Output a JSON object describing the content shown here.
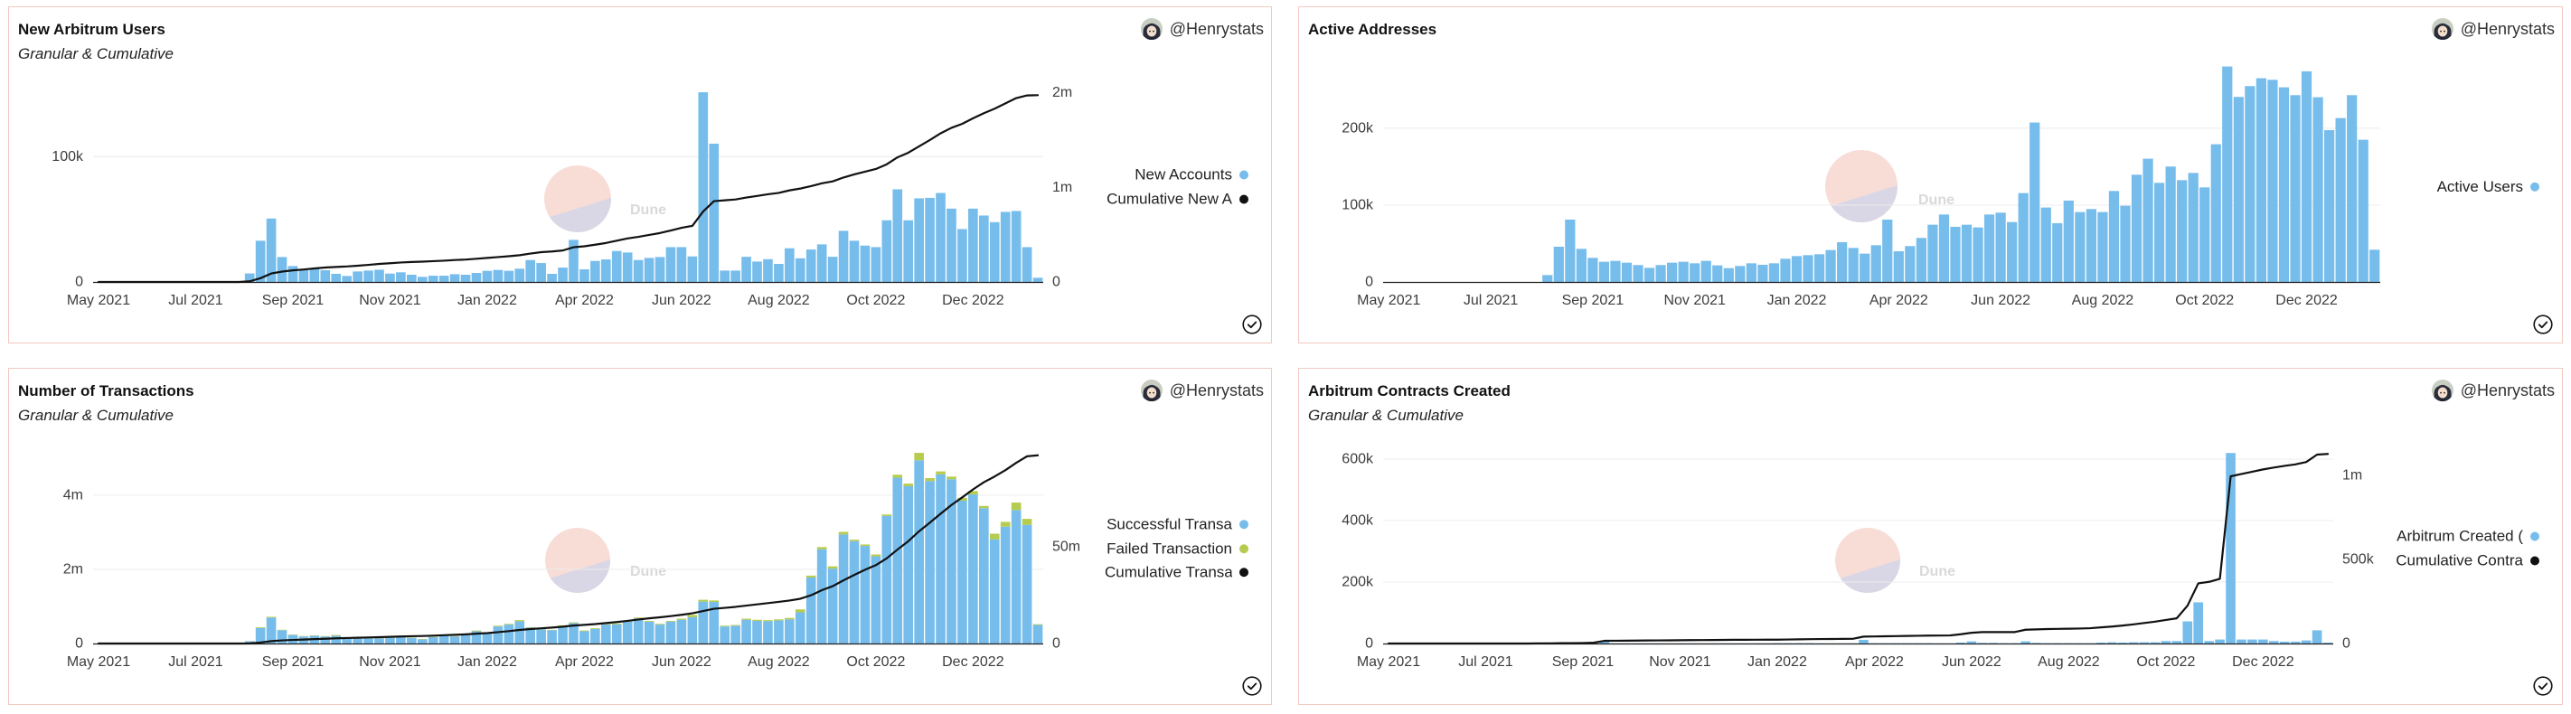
{
  "panels": [
    {
      "author": "@Henrystats"
    },
    {
      "author": "@Henrystats"
    },
    {
      "author": "@Henrystats"
    },
    {
      "author": "@Henrystats"
    }
  ],
  "watermark": {
    "text": "Dune",
    "colors": {
      "top": "#f8ddd6",
      "bottom": "#d9d7e6"
    }
  },
  "colors": {
    "bar_blue": "#77bdec",
    "failed_green": "#b6cc4e",
    "line_black": "#111111",
    "panel_border": "#f2c9c1",
    "grid": "#ececec"
  },
  "chart_data": [
    {
      "type": "bar",
      "title": "New Arbitrum Users",
      "subtitle": "Granular & Cumulative",
      "legend": "right",
      "x_count": 88,
      "x_tick_indices": [
        0,
        9,
        18,
        27,
        36,
        45,
        54,
        63,
        72,
        81
      ],
      "x_tick_labels": [
        "May 2021",
        "Jul 2021",
        "Sep 2021",
        "Nov 2021",
        "Jan 2022",
        "Apr 2022",
        "Jun 2022",
        "Aug 2022",
        "Oct 2022",
        "Dec 2022"
      ],
      "y_left": {
        "ylim": [
          0,
          160000
        ],
        "ticks": [
          0,
          100000
        ],
        "tick_labels": [
          "0",
          "100k"
        ],
        "grid": true
      },
      "y_right": {
        "ylim": [
          0,
          2120000
        ],
        "ticks": [
          0,
          1000000,
          2000000
        ],
        "tick_labels": [
          "0",
          "1m",
          "2m"
        ]
      },
      "series": [
        {
          "name": "New Accounts",
          "kind": "bar",
          "axis": "left",
          "color": "#77bdec",
          "values": [
            0,
            0,
            0,
            0,
            0,
            0,
            0,
            0,
            0,
            0,
            0,
            0,
            0,
            0,
            6800,
            32900,
            50600,
            19900,
            12700,
            9400,
            10800,
            9400,
            6500,
            4800,
            8400,
            9100,
            9800,
            6700,
            7700,
            5800,
            4100,
            5000,
            5000,
            6200,
            5800,
            7200,
            8900,
            9600,
            8900,
            10600,
            17500,
            15100,
            6500,
            11500,
            33600,
            10100,
            16800,
            18000,
            24700,
            23500,
            17500,
            19200,
            19900,
            27800,
            27800,
            20400,
            151300,
            110300,
            9100,
            9100,
            20100,
            16300,
            18200,
            14400,
            26900,
            18900,
            25900,
            30000,
            20100,
            40800,
            32900,
            29000,
            27800,
            49200,
            73900,
            49200,
            66700,
            67100,
            71000,
            58500,
            42200,
            58500,
            53000,
            47700,
            55900,
            56600,
            27800,
            3400
          ]
        },
        {
          "name": "Cumulative New A",
          "kind": "line",
          "axis": "right",
          "color": "#111111",
          "values": [
            0,
            0,
            0,
            0,
            0,
            0,
            0,
            0,
            0,
            0,
            0,
            0,
            0,
            0,
            7000,
            40000,
            90000,
            110000,
            123000,
            132000,
            143000,
            153000,
            159000,
            164000,
            172000,
            181000,
            191000,
            198000,
            206000,
            211000,
            215000,
            220000,
            225000,
            232000,
            237000,
            245000,
            254000,
            263000,
            272000,
            283000,
            300000,
            315000,
            322000,
            333000,
            367000,
            377000,
            394000,
            412000,
            436000,
            460000,
            477000,
            497000,
            517000,
            544000,
            572000,
            593000,
            744000,
            854000,
            863000,
            872000,
            892000,
            909000,
            927000,
            941000,
            968000,
            987000,
            1013000,
            1043000,
            1063000,
            1104000,
            1137000,
            1166000,
            1194000,
            1243000,
            1317000,
            1366000,
            1433000,
            1500000,
            1571000,
            1629000,
            1671000,
            1730000,
            1783000,
            1831000,
            1887000,
            1943000,
            1971000,
            1974000
          ]
        }
      ]
    },
    {
      "type": "bar",
      "title": "Active Addresses",
      "subtitle": "",
      "legend": "right",
      "x_count": 88,
      "x_tick_indices": [
        0,
        9,
        18,
        27,
        36,
        45,
        54,
        63,
        72,
        81
      ],
      "x_tick_labels": [
        "May 2021",
        "Jul 2021",
        "Sep 2021",
        "Nov 2021",
        "Jan 2022",
        "Apr 2022",
        "Jun 2022",
        "Aug 2022",
        "Oct 2022",
        "Dec 2022"
      ],
      "y_left": {
        "ylim": [
          0,
          294000
        ],
        "ticks": [
          0,
          100000,
          200000
        ],
        "tick_labels": [
          "0",
          "100k",
          "200k"
        ],
        "grid": true
      },
      "series": [
        {
          "name": "Active Users",
          "kind": "bar",
          "axis": "left",
          "color": "#77bdec",
          "values": [
            0,
            0,
            0,
            0,
            0,
            0,
            0,
            0,
            0,
            0,
            0,
            0,
            0,
            0,
            9000,
            45900,
            81200,
            43100,
            31400,
            26300,
            27500,
            25100,
            22000,
            18400,
            22000,
            25100,
            26300,
            24300,
            27500,
            21600,
            18000,
            20800,
            24300,
            22400,
            24300,
            30200,
            33700,
            34900,
            36100,
            41600,
            51800,
            44300,
            36900,
            47800,
            81200,
            40000,
            46700,
            57300,
            74500,
            87800,
            71800,
            74500,
            71000,
            87800,
            90200,
            78000,
            115700,
            207500,
            96900,
            76500,
            105900,
            91000,
            94900,
            91000,
            118400,
            99200,
            139600,
            160400,
            129000,
            150200,
            132500,
            141900,
            123100,
            179200,
            280400,
            240800,
            254900,
            265100,
            263100,
            253300,
            243100,
            274100,
            240400,
            197600,
            213300,
            243100,
            185100,
            42000
          ]
        }
      ]
    },
    {
      "type": "bar",
      "title": "Number of Transactions",
      "subtitle": "Granular & Cumulative",
      "legend": "right",
      "x_count": 88,
      "x_tick_indices": [
        0,
        9,
        18,
        27,
        36,
        45,
        54,
        63,
        72,
        81
      ],
      "x_tick_labels": [
        "May 2021",
        "Jul 2021",
        "Sep 2021",
        "Nov 2021",
        "Jan 2022",
        "Apr 2022",
        "Jun 2022",
        "Aug 2022",
        "Oct 2022",
        "Dec 2022"
      ],
      "y_left": {
        "ylim": [
          0,
          5410000
        ],
        "ticks": [
          0,
          2000000,
          4000000
        ],
        "tick_labels": [
          "0",
          "2m",
          "4m"
        ],
        "grid": true
      },
      "y_right": {
        "ylim": [
          0,
          103700000
        ],
        "ticks": [
          0,
          50000000
        ],
        "tick_labels": [
          "0",
          "50m"
        ]
      },
      "series": [
        {
          "name": "Successful Transa",
          "kind": "bar",
          "stack": "tx",
          "axis": "left",
          "color": "#77bdec",
          "values": [
            0,
            0,
            0,
            0,
            0,
            0,
            0,
            0,
            0,
            0,
            0,
            0,
            0,
            0,
            60000,
            420000,
            700000,
            360000,
            230000,
            190000,
            210000,
            190000,
            210000,
            130000,
            130000,
            140000,
            140000,
            150000,
            170000,
            150000,
            110000,
            170000,
            210000,
            190000,
            220000,
            330000,
            280000,
            460000,
            510000,
            600000,
            430000,
            380000,
            360000,
            470000,
            550000,
            330000,
            390000,
            510000,
            520000,
            590000,
            680000,
            590000,
            510000,
            590000,
            640000,
            710000,
            1130000,
            1120000,
            460000,
            480000,
            640000,
            610000,
            600000,
            620000,
            650000,
            840000,
            1780000,
            2540000,
            2020000,
            2940000,
            2760000,
            2630000,
            2350000,
            3440000,
            4470000,
            4240000,
            4940000,
            4380000,
            4560000,
            4430000,
            3850000,
            4020000,
            3650000,
            2810000,
            3150000,
            3600000,
            3200000,
            500000
          ]
        },
        {
          "name": "Failed Transaction",
          "kind": "bar",
          "stack": "tx",
          "axis": "left",
          "color": "#b6cc4e",
          "values": [
            0,
            0,
            0,
            0,
            0,
            0,
            0,
            0,
            0,
            0,
            0,
            0,
            0,
            0,
            5000,
            20000,
            20000,
            10000,
            10000,
            10000,
            10000,
            10000,
            20000,
            10000,
            10000,
            10000,
            10000,
            10000,
            10000,
            10000,
            10000,
            10000,
            10000,
            10000,
            20000,
            20000,
            20000,
            20000,
            20000,
            30000,
            10000,
            10000,
            10000,
            20000,
            20000,
            20000,
            20000,
            20000,
            20000,
            20000,
            20000,
            20000,
            20000,
            20000,
            30000,
            60000,
            50000,
            40000,
            20000,
            20000,
            30000,
            30000,
            30000,
            30000,
            40000,
            80000,
            50000,
            60000,
            60000,
            70000,
            40000,
            40000,
            50000,
            40000,
            80000,
            70000,
            200000,
            80000,
            80000,
            70000,
            80000,
            90000,
            60000,
            150000,
            130000,
            200000,
            160000,
            20000
          ]
        },
        {
          "name": "Cumulative Transa",
          "kind": "line",
          "axis": "right",
          "color": "#111111",
          "values": [
            0,
            0,
            0,
            0,
            0,
            0,
            0,
            0,
            0,
            0,
            0,
            0,
            0,
            0,
            70000,
            510000,
            1230000,
            1600000,
            1840000,
            2040000,
            2260000,
            2460000,
            2690000,
            2830000,
            2970000,
            3120000,
            3270000,
            3430000,
            3610000,
            3770000,
            3890000,
            4070000,
            4290000,
            4490000,
            4730000,
            5080000,
            5380000,
            5860000,
            6390000,
            7020000,
            7460000,
            7850000,
            8220000,
            8710000,
            9280000,
            9630000,
            10040000,
            10570000,
            11110000,
            11720000,
            12420000,
            13030000,
            13560000,
            14170000,
            14840000,
            15610000,
            16790000,
            17950000,
            18430000,
            18930000,
            19600000,
            20240000,
            20870000,
            21520000,
            22210000,
            23130000,
            24960000,
            27560000,
            29640000,
            32650000,
            35450000,
            38120000,
            40520000,
            44000000,
            48550000,
            52860000,
            58000000,
            62460000,
            67100000,
            71600000,
            75530000,
            79640000,
            83350000,
            86310000,
            89590000,
            93390000,
            96750000,
            97270000
          ]
        }
      ]
    },
    {
      "type": "bar",
      "title": "Arbitrum Contracts Created",
      "subtitle": "Granular & Cumulative",
      "legend": "right",
      "x_count": 88,
      "x_tick_indices": [
        0,
        9,
        18,
        27,
        36,
        45,
        54,
        63,
        72,
        81
      ],
      "x_tick_labels": [
        "May 2021",
        "Jul 2021",
        "Sep 2021",
        "Nov 2021",
        "Jan 2022",
        "Apr 2022",
        "Jun 2022",
        "Aug 2022",
        "Oct 2022",
        "Dec 2022"
      ],
      "y_left": {
        "ylim": [
          0,
          653000
        ],
        "ticks": [
          0,
          200000,
          400000,
          600000
        ],
        "tick_labels": [
          "0",
          "200k",
          "400k",
          "600k"
        ],
        "grid": true
      },
      "y_right": {
        "ylim": [
          0,
          1194000
        ],
        "ticks": [
          0,
          500000,
          1000000
        ],
        "tick_labels": [
          "0",
          "500k",
          "1m"
        ]
      },
      "series": [
        {
          "name": "Arbitrum Created (",
          "kind": "bar",
          "axis": "left",
          "color": "#77bdec",
          "values": [
            0,
            0,
            0,
            0,
            0,
            0,
            0,
            0,
            0,
            0,
            0,
            0,
            0,
            0,
            500,
            500,
            500,
            500,
            1000,
            2000,
            8000,
            500,
            500,
            500,
            500,
            500,
            500,
            500,
            500,
            500,
            500,
            500,
            500,
            500,
            500,
            500,
            1000,
            1000,
            1000,
            1000,
            500,
            500,
            500,
            500,
            12000,
            1000,
            1000,
            1000,
            1000,
            1000,
            1000,
            500,
            500,
            3000,
            7000,
            2000,
            2000,
            1000,
            1000,
            7000,
            2000,
            1000,
            1000,
            1000,
            1000,
            1000,
            3000,
            4000,
            3000,
            4000,
            4000,
            4000,
            8000,
            8000,
            72000,
            134000,
            8000,
            13000,
            620000,
            13000,
            13000,
            13000,
            8000,
            6000,
            6000,
            10000,
            43000,
            3000
          ]
        },
        {
          "name": "Cumulative Contra",
          "kind": "line",
          "axis": "right",
          "color": "#111111",
          "values": [
            0,
            0,
            0,
            0,
            0,
            0,
            0,
            0,
            0,
            0,
            0,
            0,
            0,
            0,
            1000,
            1000,
            2000,
            2000,
            3000,
            5000,
            16000,
            16500,
            17000,
            17500,
            18000,
            18500,
            19000,
            19500,
            20000,
            20500,
            21000,
            21500,
            22000,
            22000,
            22500,
            23000,
            23000,
            24000,
            25000,
            26000,
            26500,
            27000,
            27500,
            28000,
            41000,
            42000,
            43000,
            44000,
            45000,
            46000,
            47000,
            47500,
            48000,
            55000,
            64000,
            68000,
            68000,
            68000,
            68000,
            82000,
            84000,
            86000,
            87000,
            88000,
            89000,
            91000,
            96000,
            101000,
            107000,
            114000,
            122000,
            130000,
            140000,
            150000,
            225000,
            358000,
            367000,
            385000,
            995000,
            1009000,
            1022000,
            1036000,
            1047000,
            1057000,
            1066000,
            1080000,
            1124000,
            1128000
          ]
        }
      ]
    }
  ]
}
